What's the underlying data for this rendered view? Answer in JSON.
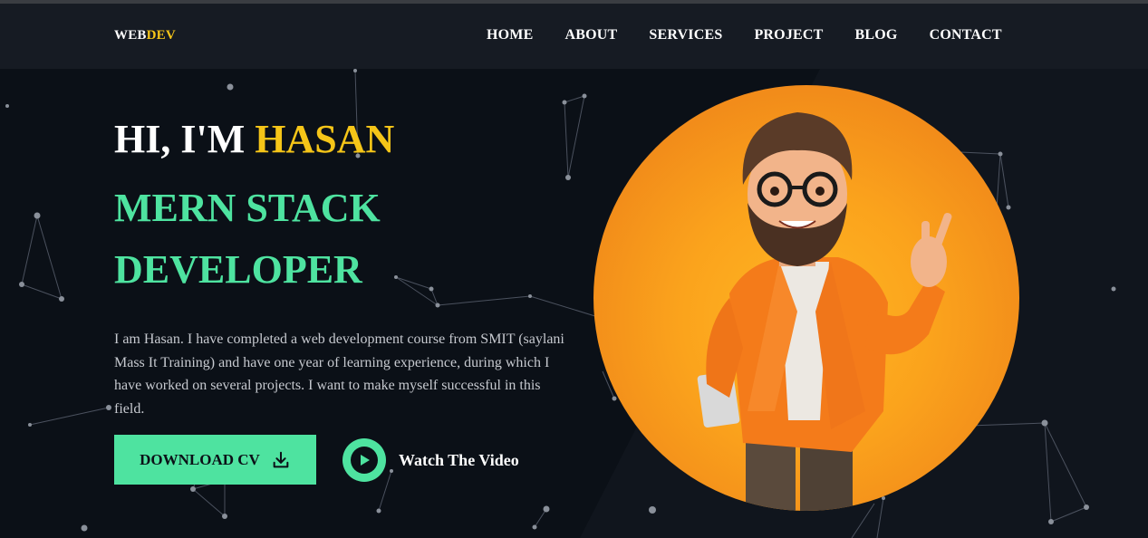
{
  "header": {
    "logo_main": "WEB",
    "logo_accent": "DEV",
    "nav": [
      "HOME",
      "ABOUT",
      "SERVICES",
      "PROJECT",
      "BLOG",
      "CONTACT"
    ]
  },
  "hero": {
    "greeting": "HI, I'M ",
    "name": "HASAN",
    "role_line1": "MERN STACK",
    "role_line2": "DEVELOPER",
    "bio": "I am Hasan. I have completed a web development course from SMIT (saylani Mass It Training) and have one year of learning experience, during which I have worked on several projects. I want to make myself successful in this field.",
    "download_label": "DOWNLOAD CV",
    "video_label": "Watch The Video"
  },
  "colors": {
    "background": "#0b1017",
    "header_bg": "#161b23",
    "accent_yellow": "#f5c518",
    "accent_green": "#4ee3a0",
    "portrait_orange": "#fba31c"
  },
  "icons": {
    "download": "download-icon",
    "play": "play-icon"
  }
}
